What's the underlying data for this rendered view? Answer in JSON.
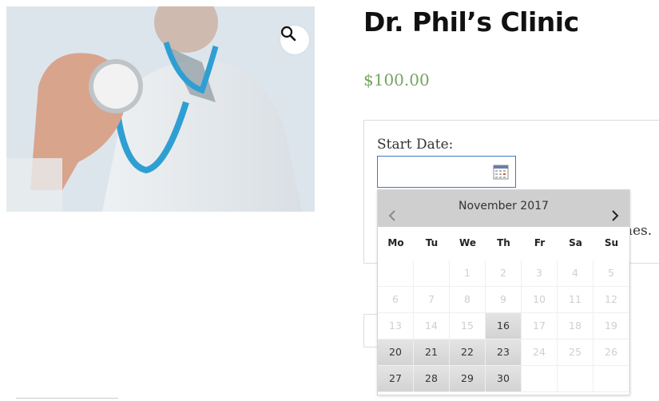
{
  "product": {
    "title": "Dr. Phil’s Clinic",
    "price": "$100.00",
    "image_icon": "doctor-stethoscope-photo",
    "zoom_icon": "magnifier-icon"
  },
  "booking": {
    "start_date_label": "Start Date:",
    "start_date_value": "",
    "calendar_icon": "calendar-icon",
    "partially_hidden_text": "nes."
  },
  "datepicker": {
    "month_label": "November 2017",
    "weekdays": [
      "Mo",
      "Tu",
      "We",
      "Th",
      "Fr",
      "Sa",
      "Su"
    ],
    "weeks": [
      [
        {
          "d": ""
        },
        {
          "d": ""
        },
        {
          "d": "1"
        },
        {
          "d": "2"
        },
        {
          "d": "3"
        },
        {
          "d": "4"
        },
        {
          "d": "5"
        }
      ],
      [
        {
          "d": "6"
        },
        {
          "d": "7"
        },
        {
          "d": "8"
        },
        {
          "d": "9"
        },
        {
          "d": "10"
        },
        {
          "d": "11"
        },
        {
          "d": "12"
        }
      ],
      [
        {
          "d": "13"
        },
        {
          "d": "14"
        },
        {
          "d": "15"
        },
        {
          "d": "16",
          "available": true
        },
        {
          "d": "17"
        },
        {
          "d": "18"
        },
        {
          "d": "19"
        }
      ],
      [
        {
          "d": "20",
          "available": true
        },
        {
          "d": "21",
          "available": true
        },
        {
          "d": "22",
          "available": true
        },
        {
          "d": "23",
          "available": true
        },
        {
          "d": "24"
        },
        {
          "d": "25"
        },
        {
          "d": "26"
        }
      ],
      [
        {
          "d": "27",
          "available": true
        },
        {
          "d": "28",
          "available": true
        },
        {
          "d": "29",
          "available": true
        },
        {
          "d": "30",
          "available": true
        },
        {
          "d": ""
        },
        {
          "d": ""
        },
        {
          "d": ""
        }
      ]
    ]
  },
  "colors": {
    "price": "#77a464",
    "input_border": "#3b7bbf",
    "header_bg": "#cfcfcf",
    "disabled_day": "#cfcfcf"
  }
}
